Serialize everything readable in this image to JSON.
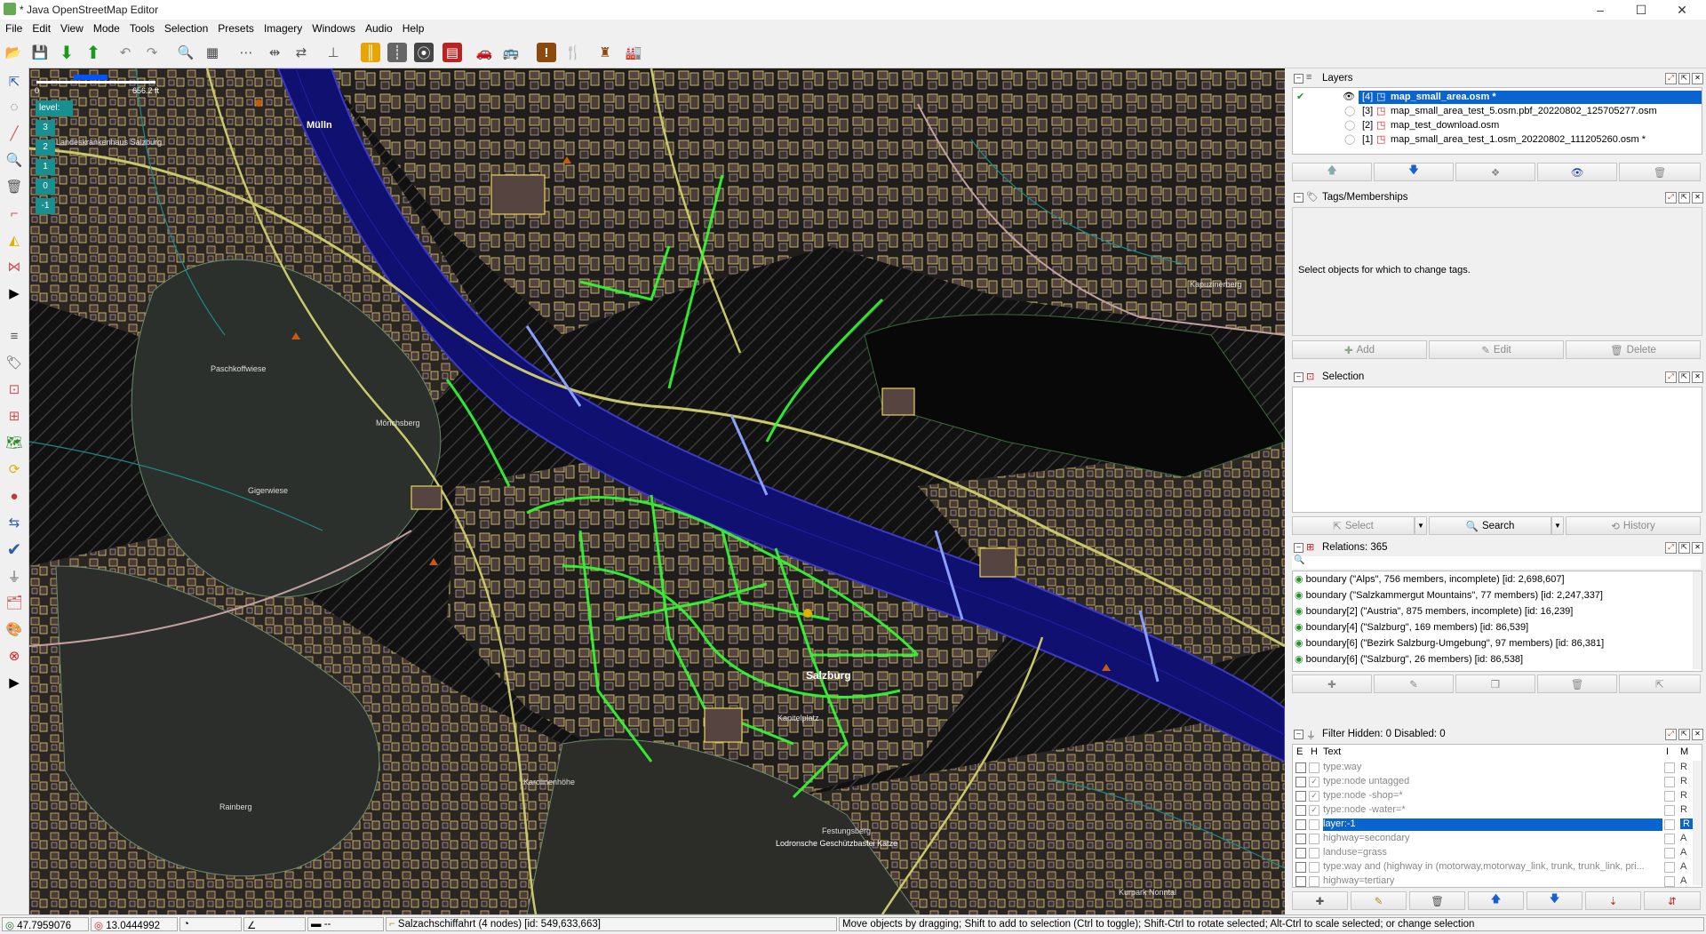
{
  "window": {
    "title": "* Java OpenStreetMap Editor",
    "minimize": "–",
    "maximize": "☐",
    "close": "✕"
  },
  "menu": [
    "File",
    "Edit",
    "View",
    "Mode",
    "Tools",
    "Selection",
    "Presets",
    "Imagery",
    "Windows",
    "Audio",
    "Help"
  ],
  "map": {
    "scale_zero": "0",
    "scale_label": "656.2 ft",
    "level_label": "level:",
    "levels": [
      "3",
      "2",
      "1",
      "0",
      "-1"
    ],
    "labels": {
      "muelln": "Mülln",
      "lkh": "Landeskrankenhaus Salzburg",
      "kapuzinerberg": "Kapuzinerberg",
      "paschkoff": "Paschkoffwiese",
      "moenchsberg": "Mönchsberg",
      "gigerwiese": "Gigerwiese",
      "salzburg": "Salzburg",
      "kapitelplatz": "Kapitelplatz",
      "karolinenhoehe": "Karolinenhöhe",
      "rainberg": "Rainberg",
      "festung": "Festungsberg",
      "lodron": "Lodronsche Geschützbastei Katze",
      "kurpark": "Kurpark Nonntal"
    }
  },
  "layers": {
    "title": "Layers",
    "items": [
      {
        "num": "[4]",
        "name": "map_small_area.osm *",
        "active": true
      },
      {
        "num": "[3]",
        "name": "map_small_area_test_5.osm.pbf_20220802_125705277.osm",
        "active": false
      },
      {
        "num": "[2]",
        "name": "map_test_download.osm",
        "active": false
      },
      {
        "num": "[1]",
        "name": "map_small_area_test_1.osm_20220802_111205260.osm *",
        "active": false
      }
    ]
  },
  "tags": {
    "title": "Tags/Memberships",
    "empty_msg": "Select objects for which to change tags.",
    "add": "Add",
    "edit": "Edit",
    "delete": "Delete"
  },
  "selection": {
    "title": "Selection",
    "select": "Select",
    "search": "Search",
    "history": "History"
  },
  "relations": {
    "title": "Relations: 365",
    "items": [
      "boundary (\"Alps\", 756 members, incomplete) [id: 2,698,607]",
      "boundary (\"Salzkammergut Mountains\", 77 members) [id: 2,247,337]",
      "boundary[2] (\"Austria\", 875 members, incomplete) [id: 16,239]",
      "boundary[4] (\"Salzburg\", 169 members) [id: 86,539]",
      "boundary[6] (\"Bezirk Salzburg-Umgebung\", 97 members) [id: 86,381]",
      "boundary[6] (\"Salzburg\", 26 members) [id: 86,538]"
    ]
  },
  "filter": {
    "title": "Filter Hidden: 0 Disabled: 0",
    "col_e": "E",
    "col_h": "H",
    "col_text": "Text",
    "col_i": "I",
    "col_m": "M",
    "rows": [
      {
        "text": "type:way",
        "m": "R",
        "h": false,
        "sel": false
      },
      {
        "text": "type:node untagged",
        "m": "R",
        "h": true,
        "sel": false
      },
      {
        "text": "type:node -shop=*",
        "m": "R",
        "h": true,
        "sel": false
      },
      {
        "text": "type:node -water=*",
        "m": "R",
        "h": true,
        "sel": false
      },
      {
        "text": "layer:-1",
        "m": "R",
        "h": false,
        "sel": true
      },
      {
        "text": "highway=secondary",
        "m": "A",
        "h": false,
        "sel": false
      },
      {
        "text": "landuse=grass",
        "m": "A",
        "h": false,
        "sel": false
      },
      {
        "text": "type:way and (highway in (motorway,motorway_link, trunk, trunk_link, pri...",
        "m": "A",
        "h": false,
        "sel": false
      },
      {
        "text": "highway=tertiary",
        "m": "A",
        "h": false,
        "sel": false
      }
    ]
  },
  "status": {
    "lat": "47.7959076",
    "lon": "13.0444992",
    "heading": "",
    "angle": "",
    "dist": "--",
    "object": "Salzachschiffahrt (4 nodes) [id: 549,633,663]",
    "help": "Move objects by dragging; Shift to add to selection (Ctrl to toggle); Shift-Ctrl to rotate selected; Alt-Ctrl to scale selected; or change selection"
  },
  "colors": {
    "water": "#101070",
    "land": "#2c2c28",
    "road": "#c9c86a",
    "filtered": "#33ff33",
    "accent": "#0066cc"
  }
}
